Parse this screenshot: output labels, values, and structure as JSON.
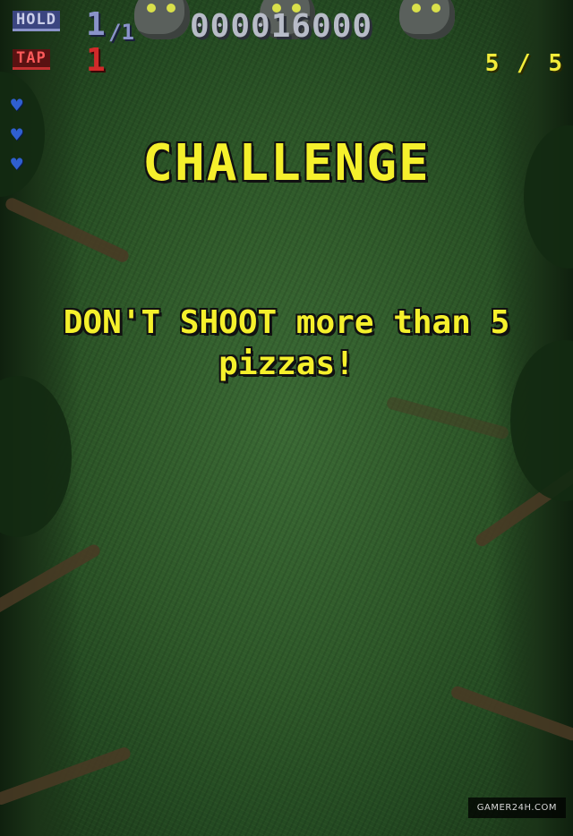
{
  "hud": {
    "hold_label": "HOLD",
    "hold_count": "1",
    "hold_max": "/1",
    "tap_label": "TAP",
    "tap_count": "1",
    "score": "000016000",
    "progress": "5 / 5",
    "lives": 3
  },
  "challenge": {
    "title": "CHALLENGE",
    "line1": "DON'T SHOOT more than 5",
    "line2": "pizzas!"
  },
  "watermark": "GAMER24H.COM",
  "colors": {
    "challenge_text": "#f5f02c",
    "hold": "#8a93c9",
    "tap": "#d12a2a",
    "heart": "#2f5fd0",
    "grass": "#2e5829"
  },
  "icons": {
    "life": "heart-icon",
    "enemy": "blob-enemy-icon"
  }
}
